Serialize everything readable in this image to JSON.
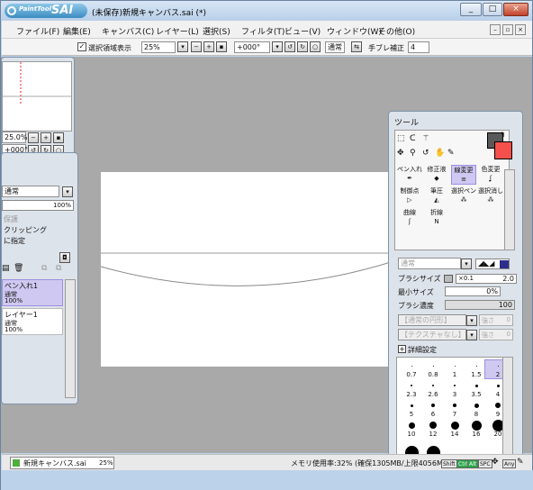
{
  "window": {
    "title": "(未保存)新規キャンバス.sai (*)",
    "logo_small": "PaintTool",
    "logo_big": "SAI",
    "controls": [
      "_",
      "□",
      "×"
    ]
  },
  "menu": [
    "ファイル(F)",
    "編集(E)",
    "キャンバス(C)",
    "レイヤー(L)",
    "選択(S)",
    "フィルタ(T)",
    "ビュー(V)",
    "ウィンドウ(W)",
    "その他(O)"
  ],
  "toolbar": {
    "selection_display_label": "選択領域表示",
    "zoom_value": "25%",
    "rotation_value": "+000°",
    "blend_mode": "通常",
    "stabilizer_label": "手ブレ補正",
    "stabilizer_value": "4"
  },
  "navigator": {
    "zoom_value": "25.0%",
    "rotation_value": "+000°"
  },
  "layer_panel": {
    "blend_mode": "通常",
    "opacity": "100%",
    "protect_label": "保護",
    "clipping_label": "クリッピング",
    "selection_source_label": "に指定",
    "layers": [
      {
        "name": "ペン入れ1",
        "mode": "通常",
        "opacity": "100%"
      },
      {
        "name": "レイヤー1",
        "mode": "通常",
        "opacity": "100%"
      }
    ]
  },
  "tool_panel": {
    "title": "ツール",
    "tools": [
      {
        "label": "ペン入れ"
      },
      {
        "label": "修正液"
      },
      {
        "label": "線変更"
      },
      {
        "label": "色変更"
      },
      {
        "label": "制御点"
      },
      {
        "label": "筆圧"
      },
      {
        "label": "選択ペン"
      },
      {
        "label": "選択消し"
      },
      {
        "label": "曲線"
      },
      {
        "label": "折線"
      }
    ],
    "mode": "通常",
    "brush_size_label": "ブラシサイズ",
    "brush_size_mult": "×0.1",
    "brush_size_value": "2.0",
    "min_size_label": "最小サイズ",
    "min_size_value": "0%",
    "density_label": "ブラシ濃度",
    "density_value": "100",
    "shape_label": "【通常の円形】",
    "shape_strength": "強さ",
    "texture_label": "【テクスチャなし】",
    "texture_strength": "強さ",
    "strength_value": "0",
    "detail_label": "詳細設定",
    "sizes": [
      "0.7",
      "0.8",
      "1",
      "1.5",
      "2",
      "2.3",
      "2.6",
      "3",
      "3.5",
      "4",
      "5",
      "6",
      "7",
      "8",
      "9",
      "10",
      "12",
      "14",
      "16",
      "20"
    ],
    "selected_size": "2",
    "primary_color": "#595959",
    "secondary_color": "#f6504d"
  },
  "statusbar": {
    "file_name": "新規キャンバス.sai",
    "file_zoom": "25%",
    "memory": "メモリ使用率:32% (確保1305MB/上限4056MB)",
    "keys": [
      "Shift",
      "Ctrl",
      "Alt",
      "SPC",
      "Any"
    ]
  },
  "colors": {
    "title_bg": "#bcd2ea",
    "canvas_bg": "#a9a9a9",
    "selected_layer": "#cfc8f0",
    "key_on": "#2aa74a"
  }
}
